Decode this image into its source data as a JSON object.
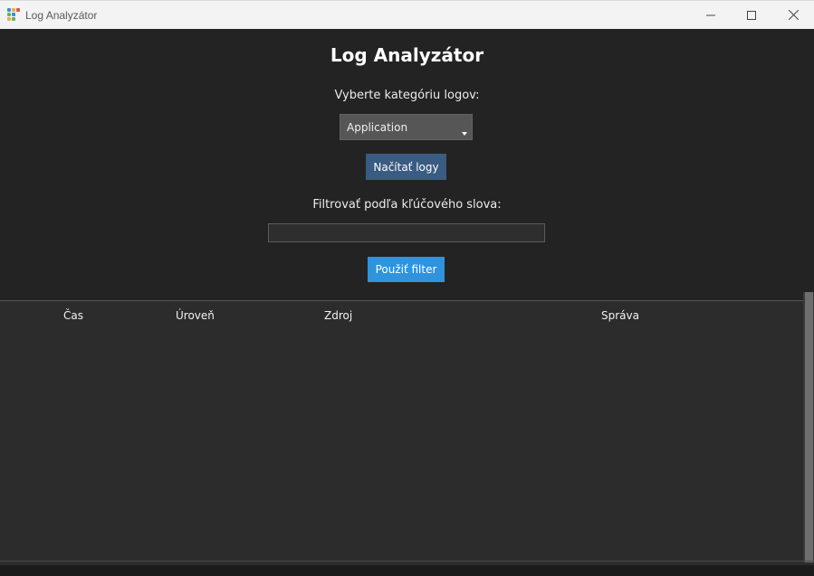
{
  "window": {
    "title": "Log Analyzátor",
    "icon": "app-grid-icon",
    "controls": [
      "minimize-icon",
      "maximize-icon",
      "close-icon"
    ]
  },
  "main": {
    "heading": "Log Analyzátor",
    "category_label": "Vyberte kategóriu logov:",
    "category_select": {
      "value": "Application"
    },
    "load_button": "Načítať logy",
    "filter_label": "Filtrovať podľa kľúčového slova:",
    "filter_input": {
      "value": "",
      "placeholder": ""
    },
    "filter_button": "Použiť filter"
  },
  "table": {
    "columns": [
      "Čas",
      "Úroveň",
      "Zdroj",
      "Správa"
    ],
    "rows": []
  },
  "colors": {
    "background": "#232323",
    "load_button": "#3a5b82",
    "filter_button": "#2f93dd",
    "table_background": "#2c2c2c"
  }
}
